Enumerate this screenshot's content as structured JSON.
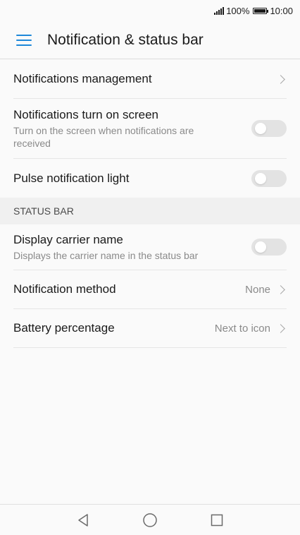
{
  "status_bar": {
    "battery_percent_text": "100%",
    "time": "10:00",
    "battery_level": 1.0
  },
  "app_bar": {
    "title": "Notification & status bar"
  },
  "rows_top": [
    {
      "title": "Notifications management"
    },
    {
      "title": "Notifications turn on screen",
      "subtitle": "Turn on the screen when notifications are received",
      "toggle_on": false
    },
    {
      "title": "Pulse notification light",
      "toggle_on": false
    }
  ],
  "section": {
    "header": "STATUS BAR"
  },
  "rows_status": [
    {
      "title": "Display carrier name",
      "subtitle": "Displays the carrier name in the status bar",
      "toggle_on": false
    },
    {
      "title": "Notification method",
      "value": "None"
    },
    {
      "title": "Battery percentage",
      "value": "Next to icon"
    }
  ],
  "nav": {
    "back_icon": "back-triangle-icon",
    "home_icon": "home-circle-icon",
    "recents_icon": "recents-square-icon"
  },
  "colors": {
    "accent": "#1e88d9",
    "toggle_off": "#e3e3e3"
  }
}
